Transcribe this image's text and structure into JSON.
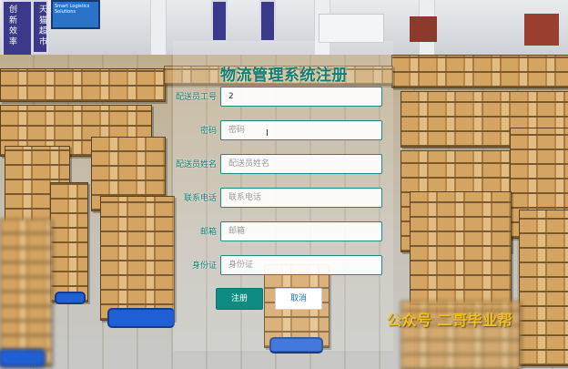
{
  "page_title": "物流管理系统注册",
  "form": {
    "fields": [
      {
        "label": "配送员工号",
        "value": "2",
        "placeholder": ""
      },
      {
        "label": "密码",
        "value": "",
        "placeholder": "密码"
      },
      {
        "label": "配送员姓名",
        "value": "",
        "placeholder": "配送员姓名"
      },
      {
        "label": "联系电话",
        "value": "",
        "placeholder": "联系电话"
      },
      {
        "label": "邮箱",
        "value": "",
        "placeholder": "邮箱"
      },
      {
        "label": "身份证",
        "value": "",
        "placeholder": "身份证"
      }
    ],
    "register_label": "注册",
    "cancel_label": "取消"
  },
  "watermark": "公众号 二哥毕业帮",
  "background_signs": {
    "left_banner_1": "创 新 效 率",
    "left_banner_2": "天 猫 超 市",
    "screen": "Smart Logistics Solutions"
  },
  "colors": {
    "accent": "#0f8c82",
    "title": "#0f7f73",
    "cancel_text": "#1673b8",
    "watermark": "#f2c21a"
  }
}
